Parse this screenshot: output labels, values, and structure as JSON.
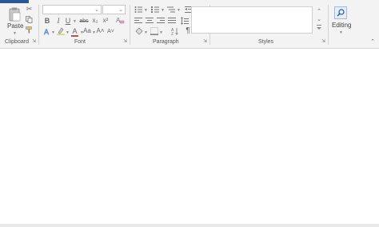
{
  "ribbon": {
    "clipboard": {
      "label": "Clipboard",
      "paste_label": "Paste"
    },
    "font": {
      "label": "Font"
    },
    "paragraph": {
      "label": "Paragraph"
    },
    "styles": {
      "label": "Styles"
    },
    "editing": {
      "label": "Editing"
    }
  },
  "font_buttons": {
    "bold": "B",
    "italic": "I",
    "underline": "U",
    "strike": "abc",
    "subscript": "x₂",
    "superscript": "x²",
    "font_color": "A",
    "change_case": "Aa",
    "grow": "A˄",
    "shrink": "A˅"
  },
  "paragraph_buttons": {
    "pilcrow": "¶"
  },
  "colors": {
    "ribbon_bg": "#f3f3f3",
    "accent": "#2b579a",
    "separator": "#d4d4d4"
  }
}
